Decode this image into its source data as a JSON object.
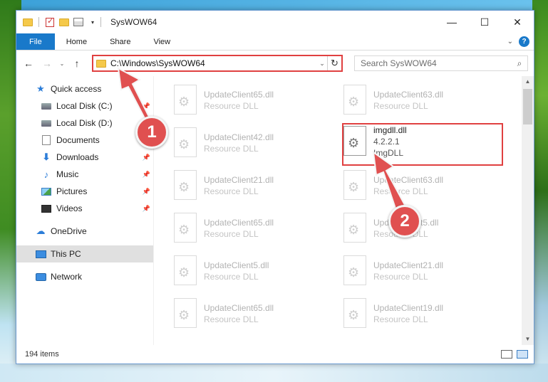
{
  "window": {
    "title": "SysWOW64",
    "controls": {
      "minimize": "—",
      "maximize": "☐",
      "close": "✕"
    }
  },
  "ribbon": {
    "tabs": [
      "File",
      "Home",
      "Share",
      "View"
    ],
    "help": "?"
  },
  "navbar": {
    "back": "←",
    "forward": "→",
    "recent": "⌄",
    "up": "↑",
    "address": "C:\\Windows\\SysWOW64",
    "refresh": "↻",
    "search_placeholder": "Search SysWOW64"
  },
  "sidebar": {
    "items": [
      {
        "label": "Quick access",
        "icon": "star-icon"
      },
      {
        "label": "Local Disk (C:)",
        "icon": "disk-icon",
        "pinned": true
      },
      {
        "label": "Local Disk (D:)",
        "icon": "disk-icon"
      },
      {
        "label": "Documents",
        "icon": "documents-icon"
      },
      {
        "label": "Downloads",
        "icon": "downloads-icon",
        "pinned": true
      },
      {
        "label": "Music",
        "icon": "music-icon",
        "pinned": true
      },
      {
        "label": "Pictures",
        "icon": "pictures-icon",
        "pinned": true
      },
      {
        "label": "Videos",
        "icon": "videos-icon",
        "pinned": true
      },
      {
        "label": "OneDrive",
        "icon": "cloud-icon"
      },
      {
        "label": "This PC",
        "icon": "computer-icon",
        "selected": true
      },
      {
        "label": "Network",
        "icon": "network-icon"
      }
    ]
  },
  "files": [
    {
      "name": "UpdateClient65.dll",
      "desc": "Resource DLL"
    },
    {
      "name": "UpdateClient63.dll",
      "desc": "Resource DLL"
    },
    {
      "name": "UpdateClient42.dll",
      "desc": "Resource DLL"
    },
    {
      "name": "imgdll.dll",
      "version": "4.2.2.1",
      "desc": "ImgDLL",
      "highlighted": true
    },
    {
      "name": "UpdateClient21.dll",
      "desc": "Resource DLL"
    },
    {
      "name": "UpdateClient63.dll",
      "desc": "Resource DLL"
    },
    {
      "name": "UpdateClient65.dll",
      "desc": "Resource DLL"
    },
    {
      "name": "UpdateClient5.dll",
      "desc": "Resource DLL"
    },
    {
      "name": "UpdateClient5.dll",
      "desc": "Resource DLL"
    },
    {
      "name": "UpdateClient21.dll",
      "desc": "Resource DLL"
    },
    {
      "name": "UpdateClient65.dll",
      "desc": "Resource DLL"
    },
    {
      "name": "UpdateClient19.dll",
      "desc": "Resource DLL"
    }
  ],
  "status": {
    "item_count": "194 items"
  },
  "callouts": [
    "1",
    "2"
  ],
  "colors": {
    "accent": "#1979ca",
    "highlight": "#e04040",
    "callout": "#e05050"
  }
}
